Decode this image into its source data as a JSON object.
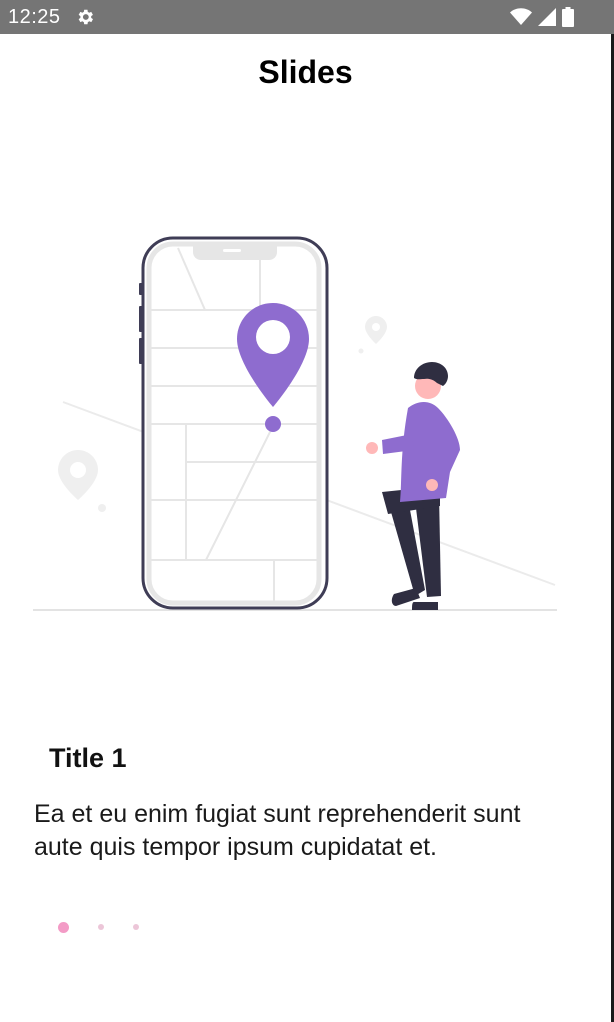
{
  "status_bar": {
    "time": "12:25",
    "icons": [
      "gear-icon",
      "wifi-icon",
      "signal-icon",
      "battery-icon"
    ]
  },
  "header": {
    "title": "Slides"
  },
  "slide": {
    "illustration": "map-pin-phone-illustration",
    "title": "Title 1",
    "body": "Ea et eu enim fugiat sunt reprehenderit sunt aute quis tempor ipsum cupidatat et."
  },
  "pager": {
    "count": 3,
    "active_index": 0
  },
  "colors": {
    "status_bar": "#757575",
    "accent": "#8e6ccf",
    "dot_active": "#f39bc6",
    "dot_inactive": "#ecc6d8",
    "phone_outline": "#3f3d56"
  }
}
